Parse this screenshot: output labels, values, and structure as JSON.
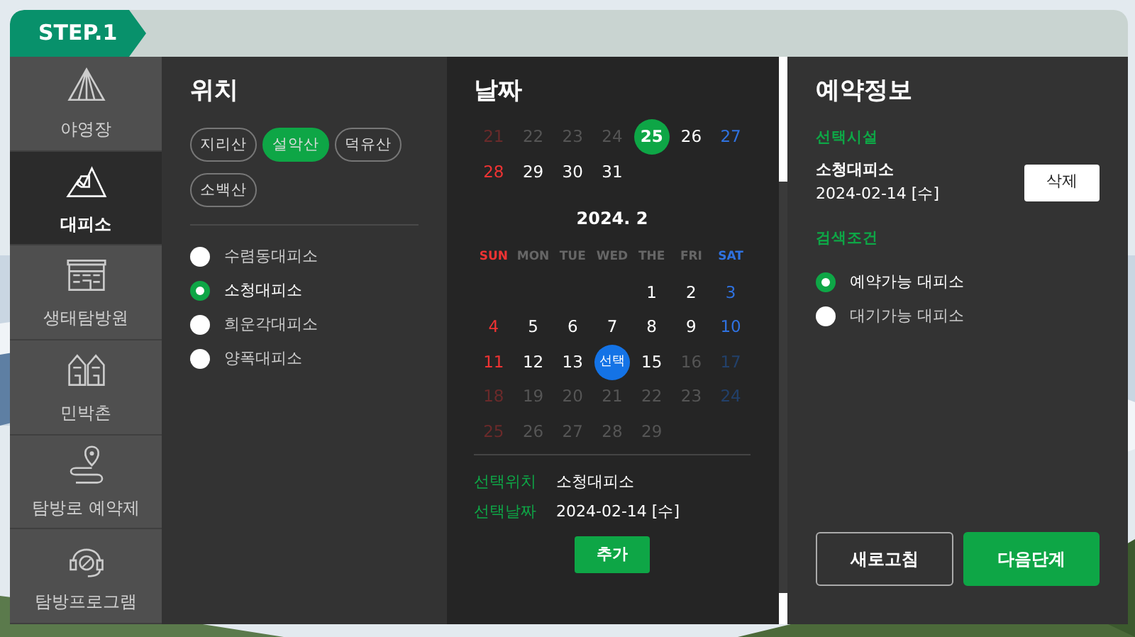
{
  "step": "STEP.1",
  "sidebar": {
    "items": [
      {
        "label": "야영장",
        "selected": false
      },
      {
        "label": "대피소",
        "selected": true
      },
      {
        "label": "생태탐방원",
        "selected": false
      },
      {
        "label": "민박촌",
        "selected": false
      },
      {
        "label": "탐방로 예약제",
        "selected": false
      },
      {
        "label": "탐방프로그램",
        "selected": false
      }
    ]
  },
  "location": {
    "title": "위치",
    "mountains": [
      {
        "label": "지리산",
        "selected": false
      },
      {
        "label": "설악산",
        "selected": true
      },
      {
        "label": "덕유산",
        "selected": false
      },
      {
        "label": "소백산",
        "selected": false
      }
    ],
    "shelters": [
      {
        "label": "수렴동대피소",
        "selected": false
      },
      {
        "label": "소청대피소",
        "selected": true
      },
      {
        "label": "희운각대피소",
        "selected": false
      },
      {
        "label": "양폭대피소",
        "selected": false
      }
    ]
  },
  "date": {
    "title": "날짜",
    "months": [
      {
        "weeks": [
          [
            {
              "kind": "day",
              "text": "21",
              "disabled": true,
              "today": false,
              "selected": false
            },
            {
              "kind": "day",
              "text": "22",
              "disabled": true,
              "today": false,
              "selected": false
            },
            {
              "kind": "day",
              "text": "23",
              "disabled": true,
              "today": false,
              "selected": false
            },
            {
              "kind": "day",
              "text": "24",
              "disabled": true,
              "today": false,
              "selected": false
            },
            {
              "kind": "day",
              "text": "25",
              "disabled": false,
              "today": true,
              "selected": false
            },
            {
              "kind": "day",
              "text": "26",
              "disabled": false,
              "today": false,
              "selected": false
            },
            {
              "kind": "day",
              "text": "27",
              "disabled": false,
              "today": false,
              "selected": false
            }
          ],
          [
            {
              "kind": "day",
              "text": "28",
              "disabled": false,
              "today": false,
              "selected": false
            },
            {
              "kind": "day",
              "text": "29",
              "disabled": false,
              "today": false,
              "selected": false
            },
            {
              "kind": "day",
              "text": "30",
              "disabled": false,
              "today": false,
              "selected": false
            },
            {
              "kind": "day",
              "text": "31",
              "disabled": false,
              "today": false,
              "selected": false
            },
            {
              "kind": "blank"
            },
            {
              "kind": "blank"
            },
            {
              "kind": "blank"
            }
          ]
        ]
      },
      {
        "title": "2024. 2",
        "weekdays": [
          "SUN",
          "MON",
          "TUE",
          "WED",
          "THE",
          "FRI",
          "SAT"
        ],
        "weeks": [
          [
            {
              "kind": "blank"
            },
            {
              "kind": "blank"
            },
            {
              "kind": "blank"
            },
            {
              "kind": "blank"
            },
            {
              "kind": "day",
              "text": "1",
              "disabled": false,
              "today": false,
              "selected": false
            },
            {
              "kind": "day",
              "text": "2",
              "disabled": false,
              "today": false,
              "selected": false
            },
            {
              "kind": "day",
              "text": "3",
              "disabled": false,
              "today": false,
              "selected": false
            }
          ],
          [
            {
              "kind": "day",
              "text": "4",
              "disabled": false,
              "today": false,
              "selected": false
            },
            {
              "kind": "day",
              "text": "5",
              "disabled": false,
              "today": false,
              "selected": false
            },
            {
              "kind": "day",
              "text": "6",
              "disabled": false,
              "today": false,
              "selected": false
            },
            {
              "kind": "day",
              "text": "7",
              "disabled": false,
              "today": false,
              "selected": false
            },
            {
              "kind": "day",
              "text": "8",
              "disabled": false,
              "today": false,
              "selected": false
            },
            {
              "kind": "day",
              "text": "9",
              "disabled": false,
              "today": false,
              "selected": false
            },
            {
              "kind": "day",
              "text": "10",
              "disabled": false,
              "today": false,
              "selected": false
            }
          ],
          [
            {
              "kind": "day",
              "text": "11",
              "disabled": false,
              "today": false,
              "selected": false
            },
            {
              "kind": "day",
              "text": "12",
              "disabled": false,
              "today": false,
              "selected": false
            },
            {
              "kind": "day",
              "text": "13",
              "disabled": false,
              "today": false,
              "selected": false
            },
            {
              "kind": "day",
              "text": "선택",
              "disabled": false,
              "today": false,
              "selected": true
            },
            {
              "kind": "day",
              "text": "15",
              "disabled": false,
              "today": false,
              "selected": false
            },
            {
              "kind": "day",
              "text": "16",
              "disabled": true,
              "today": false,
              "selected": false
            },
            {
              "kind": "day",
              "text": "17",
              "disabled": true,
              "today": false,
              "selected": false
            }
          ],
          [
            {
              "kind": "day",
              "text": "18",
              "disabled": true,
              "today": false,
              "selected": false
            },
            {
              "kind": "day",
              "text": "19",
              "disabled": true,
              "today": false,
              "selected": false
            },
            {
              "kind": "day",
              "text": "20",
              "disabled": true,
              "today": false,
              "selected": false
            },
            {
              "kind": "day",
              "text": "21",
              "disabled": true,
              "today": false,
              "selected": false
            },
            {
              "kind": "day",
              "text": "22",
              "disabled": true,
              "today": false,
              "selected": false
            },
            {
              "kind": "day",
              "text": "23",
              "disabled": true,
              "today": false,
              "selected": false
            },
            {
              "kind": "day",
              "text": "24",
              "disabled": true,
              "today": false,
              "selected": false
            }
          ],
          [
            {
              "kind": "day",
              "text": "25",
              "disabled": true,
              "today": false,
              "selected": false
            },
            {
              "kind": "day",
              "text": "26",
              "disabled": true,
              "today": false,
              "selected": false
            },
            {
              "kind": "day",
              "text": "27",
              "disabled": true,
              "today": false,
              "selected": false
            },
            {
              "kind": "day",
              "text": "28",
              "disabled": true,
              "today": false,
              "selected": false
            },
            {
              "kind": "day",
              "text": "29",
              "disabled": true,
              "today": false,
              "selected": false
            },
            {
              "kind": "blank"
            },
            {
              "kind": "blank"
            }
          ]
        ]
      }
    ],
    "summary": [
      {
        "label": "선택위치",
        "value": "소청대피소"
      },
      {
        "label": "선택날짜",
        "value": "2024-02-14 [수]"
      }
    ],
    "add_button": "추가"
  },
  "reservation": {
    "title": "예약정보",
    "facility_label": "선택시설",
    "facility_name": "소청대피소",
    "facility_date": "2024-02-14 [수]",
    "delete_button": "삭제",
    "filter_label": "검색조건",
    "filters": [
      {
        "label": "예약가능 대피소",
        "selected": true
      },
      {
        "label": "대기가능 대피소",
        "selected": false
      }
    ],
    "buttons": [
      {
        "label": "새로고침",
        "kind": "outline"
      },
      {
        "label": "다음단계",
        "kind": "primary"
      }
    ]
  }
}
